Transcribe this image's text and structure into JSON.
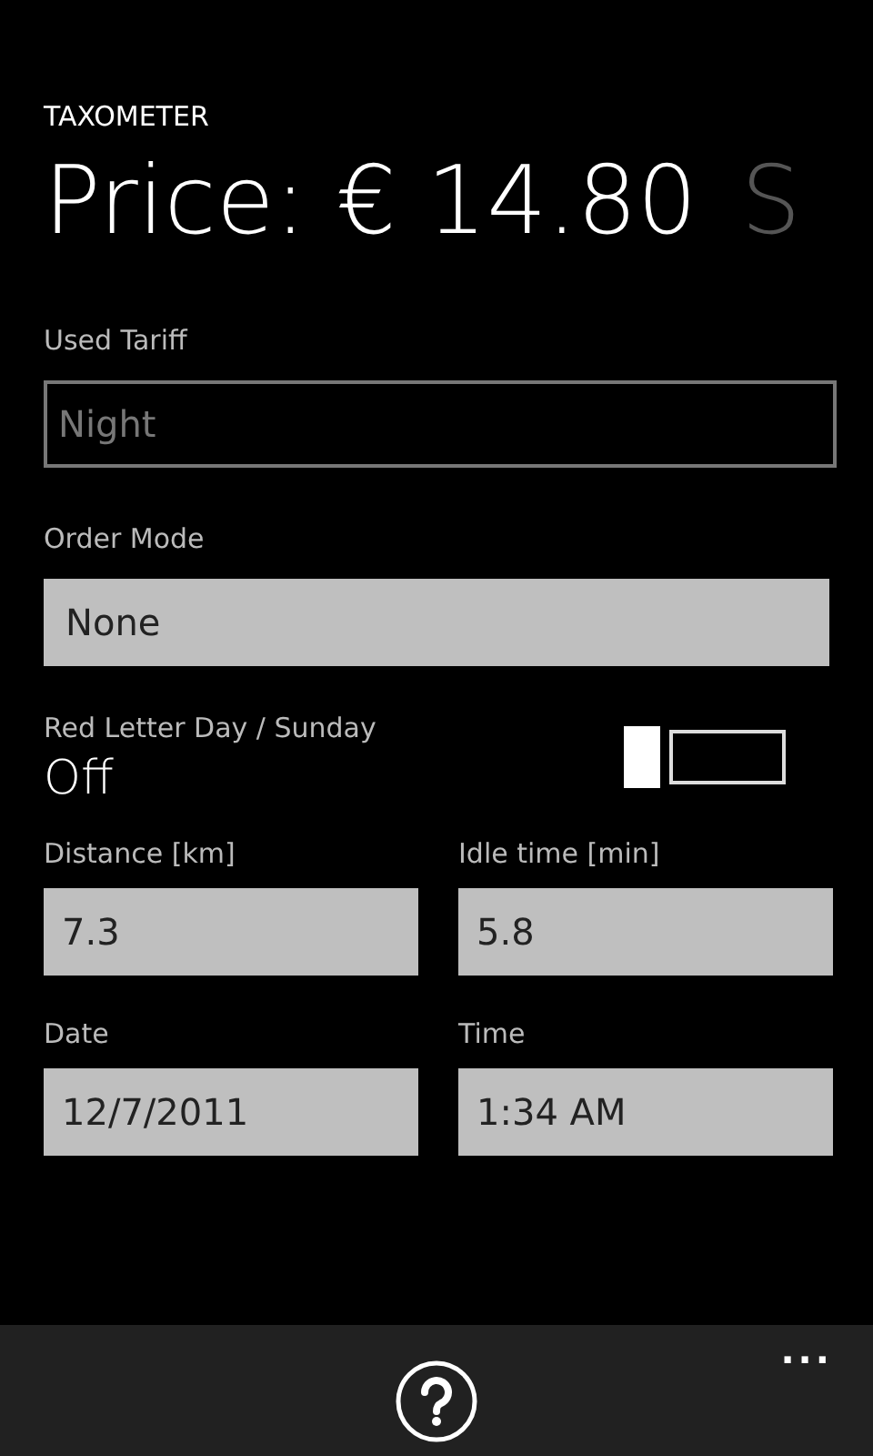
{
  "app_title": "TAXOMETER",
  "pivot_headers": [
    {
      "label": "Price: € 14.80",
      "selected": true
    },
    {
      "label": "S",
      "selected": false
    }
  ],
  "used_tariff": {
    "label": "Used Tariff",
    "value": "Night",
    "disabled": true
  },
  "order_mode": {
    "label": "Order Mode",
    "value": "None",
    "disabled": false
  },
  "red_letter_day": {
    "label": "Red Letter Day / Sunday",
    "state_text": "Off",
    "on": false
  },
  "fields": [
    {
      "label": "Distance [km]",
      "value": "7.3",
      "disabled": false
    },
    {
      "label": "Idle time [min]",
      "value": "5.8",
      "disabled": false
    },
    {
      "label": "Date",
      "value": "12/7/2011",
      "disabled": false
    },
    {
      "label": "Time",
      "value": "1:34 AM",
      "disabled": false
    }
  ],
  "app_bar": {
    "more": "..."
  }
}
